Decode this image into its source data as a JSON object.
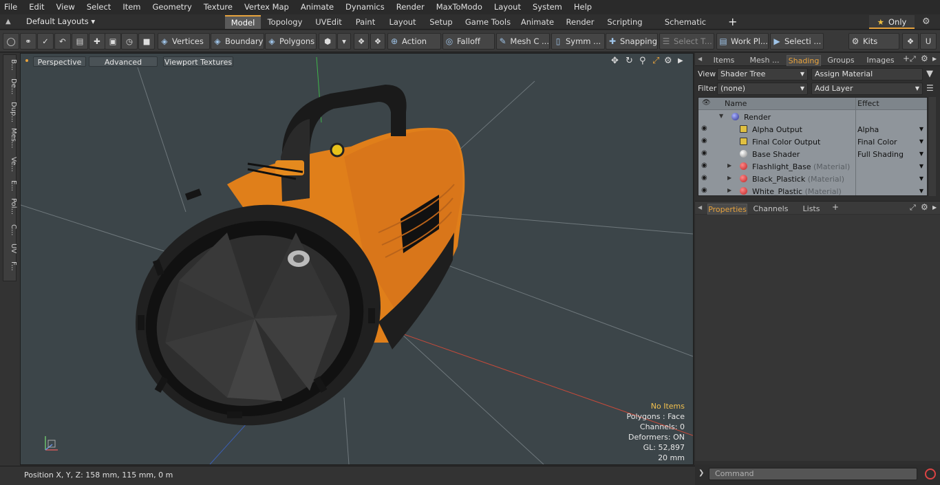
{
  "menu": [
    "File",
    "Edit",
    "View",
    "Select",
    "Item",
    "Geometry",
    "Texture",
    "Vertex Map",
    "Animate",
    "Dynamics",
    "Render",
    "MaxToModo",
    "Layout",
    "System",
    "Help"
  ],
  "layout_selector": "Default Layouts ▾",
  "tabs": [
    "Model",
    "Topology",
    "UVEdit",
    "Paint",
    "Layout",
    "Setup",
    "Game Tools",
    "Animate",
    "Render",
    "Scripting",
    "Schematic Fusion"
  ],
  "active_tab": "Model",
  "only_button": "Only",
  "toolbar": {
    "vertices": "Vertices",
    "boundary": "Boundary",
    "polygons": "Polygons",
    "action": "Action",
    "falloff": "Falloff",
    "mesh_c": "Mesh C ...",
    "symm": "Symm ...",
    "snapping": "Snapping",
    "select_t": "Select T...",
    "work_pl": "Work Pl...",
    "selecti": "Selecti ...",
    "kits": "Kits"
  },
  "left_tabs": [
    "B...",
    "De...",
    "Dup...",
    "Mes...",
    "Ve...",
    "E...",
    "Pol...",
    "C...",
    "UV",
    "F..."
  ],
  "viewport": {
    "perspective": "Perspective",
    "advanced": "Advanced",
    "textures": "Viewport Textures",
    "info": {
      "items": "No Items",
      "polygons": "Polygons : Face",
      "channels": "Channels: 0",
      "deformers": "Deformers: ON",
      "gl": "GL: 52,897",
      "scale": "20 mm"
    }
  },
  "status": {
    "position": "Position X, Y, Z:  158 mm, 115 mm, 0 m"
  },
  "right_tabs": [
    "Items",
    "Mesh ...",
    "Shading",
    "Groups",
    "Images"
  ],
  "right_active": "Shading",
  "view_label": "View",
  "view_value": "Shader Tree",
  "assign_material": "Assign Material",
  "filter_label": "Filter",
  "filter_value": "(none)",
  "add_layer": "Add Layer",
  "tree": {
    "col_name": "Name",
    "col_effect": "Effect",
    "rows": [
      {
        "name": "Render",
        "sub": "",
        "effect": ""
      },
      {
        "name": "Alpha Output",
        "sub": "",
        "effect": "Alpha"
      },
      {
        "name": "Final Color Output",
        "sub": "",
        "effect": "Final Color"
      },
      {
        "name": "Base Shader",
        "sub": "",
        "effect": "Full Shading"
      },
      {
        "name": "Flashlight_Base",
        "sub": "(Material)",
        "effect": ""
      },
      {
        "name": "Black_Plastick",
        "sub": "(Material)",
        "effect": ""
      },
      {
        "name": "White_Plastic",
        "sub": "(Material)",
        "effect": ""
      }
    ]
  },
  "property_tabs": [
    "Properties",
    "Channels",
    "Lists"
  ],
  "property_active": "Properties",
  "command_placeholder": "Command",
  "colors": {
    "accent": "#e8a33d",
    "body": "#e07f1a",
    "viewport_bg": "#3c4549"
  }
}
